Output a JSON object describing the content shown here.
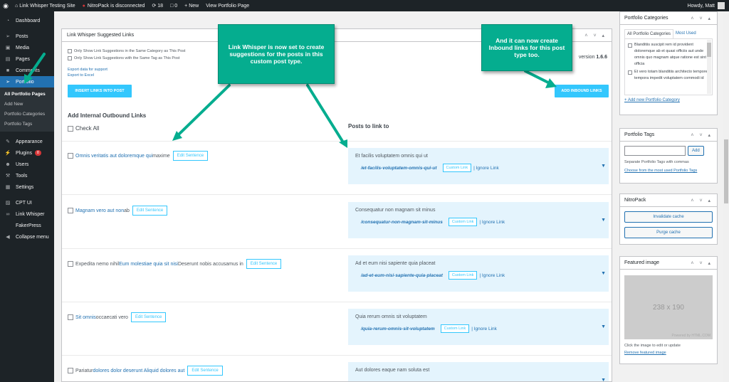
{
  "adminbar": {
    "site": "Link Whisper Testing Site",
    "nitro": "NitroPack is disconnected",
    "updates": "18",
    "comments": "0",
    "new": "New",
    "view": "View Portfolio Page",
    "howdy": "Howdy, Matt"
  },
  "menu": {
    "items": [
      {
        "label": "Dashboard",
        "icon": "dashboard-icon"
      },
      {
        "label": "Posts",
        "icon": "pin-icon"
      },
      {
        "label": "Media",
        "icon": "media-icon"
      },
      {
        "label": "Pages",
        "icon": "pages-icon"
      },
      {
        "label": "Comments",
        "icon": "comments-icon"
      },
      {
        "label": "Portfolio",
        "icon": "pin-icon"
      }
    ],
    "sub": [
      "All Portfolio Pages",
      "Add New",
      "Portfolio Categories",
      "Portfolio Tags"
    ],
    "items2": [
      {
        "label": "Appearance",
        "icon": "brush-icon"
      },
      {
        "label": "Plugins",
        "icon": "plugin-icon",
        "badge": "8"
      },
      {
        "label": "Users",
        "icon": "users-icon"
      },
      {
        "label": "Tools",
        "icon": "tools-icon"
      },
      {
        "label": "Settings",
        "icon": "settings-icon"
      },
      {
        "label": "CPT UI",
        "icon": "cpt-icon"
      },
      {
        "label": "Link Whisper",
        "icon": "link-icon"
      },
      {
        "label": "FakerPress",
        "icon": ""
      },
      {
        "label": "Collapse menu",
        "icon": "collapse-icon"
      }
    ]
  },
  "main": {
    "title": "Link Whisper Suggested Links",
    "opt1": "Only Show Link Suggestions in the Same Category as This Post",
    "opt2": "Only Show Link Suggestions with the Same Tag as This Post",
    "export_support": "Export data for support",
    "export_excel": "Export to Excel",
    "version_label": "version",
    "version": "1.6.6",
    "insert_btn": "INSERT LINKS INTO POST",
    "inbound_btn": "ADD INBOUND LINKS",
    "outbound_heading": "Add Internal Outbound Links",
    "check_all": "Check All",
    "posts_heading": "Posts to link to",
    "edit_sentence": "Edit Sentence",
    "custom_link": "Custom Link",
    "ignore_link": "| Ignore Link",
    "rows": [
      {
        "left_link": "Omnis veritatis aut doloremque qui",
        "left_pre": "",
        "left_post": " maxime",
        "sugg_title": "Et facilis voluptatem omnis qui ut",
        "sugg_path": "/et-facilis-voluptatem-omnis-qui-ut"
      },
      {
        "left_link": "Magnam vero aut non",
        "left_pre": "",
        "left_post": " ab",
        "sugg_title": "Consequatur non magnam sit minus",
        "sugg_path": "/consequatur-non-magnam-sit-minus"
      },
      {
        "left_pre": "Expedita nemo nihil ",
        "left_link": "Eum molestiae quia sit nisi",
        "left_post": " Deserunt nobis accusamus in",
        "sugg_title": "Ad et eum nisi sapiente quia placeat",
        "sugg_path": "/ad-et-eum-nisi-sapiente-quia-placeat"
      },
      {
        "left_link": "Sit omnis",
        "left_pre": "",
        "left_post": " occaecati vero",
        "sugg_title": "Quia rerum omnis sit voluptatem",
        "sugg_path": "/quia-rerum-omnis-sit-voluptatem"
      },
      {
        "left_pre": "Pariatur ",
        "left_link": "dolores dolor deserunt Aliquid dolores aut",
        "left_post": "",
        "sugg_title": "Aut dolores eaque nam soluta est",
        "sugg_path": ""
      }
    ]
  },
  "callouts": {
    "left": "Link Whisper is now set to create suggestions for the posts in this custom post type.",
    "right": "And it can now create Inbound links for this post type too."
  },
  "sidebar": {
    "categories": {
      "title": "Portfolio Categories",
      "tab_all": "All Portfolio Categories",
      "tab_used": "Most Used",
      "items": [
        "Blanditiis suscipit rem id provident doloremque ab et quasi officiis aut unde omnis quo magnam atque ratione est sint officia",
        "Et vero totam blanditiis architecto tempore tempora impedit voluptatem commodi id"
      ],
      "add_new": "+ Add new Portfolio Category"
    },
    "tags": {
      "title": "Portfolio Tags",
      "add": "Add",
      "note": "Separate Portfolio Tags with commas",
      "choose": "Choose from the most used Portfolio Tags"
    },
    "nitropack": {
      "title": "NitroPack",
      "invalidate": "Invalidate cache",
      "purge": "Purge cache"
    },
    "featured": {
      "title": "Featured image",
      "placeholder": "238 x 190",
      "watermark": "Powered by HTML.COM",
      "click_note": "Click the image to edit or update",
      "remove": "Remove featured image"
    }
  },
  "colors": {
    "callout": "#05ad8f",
    "accent": "#33c7fd",
    "admin_blue": "#2271b1"
  }
}
